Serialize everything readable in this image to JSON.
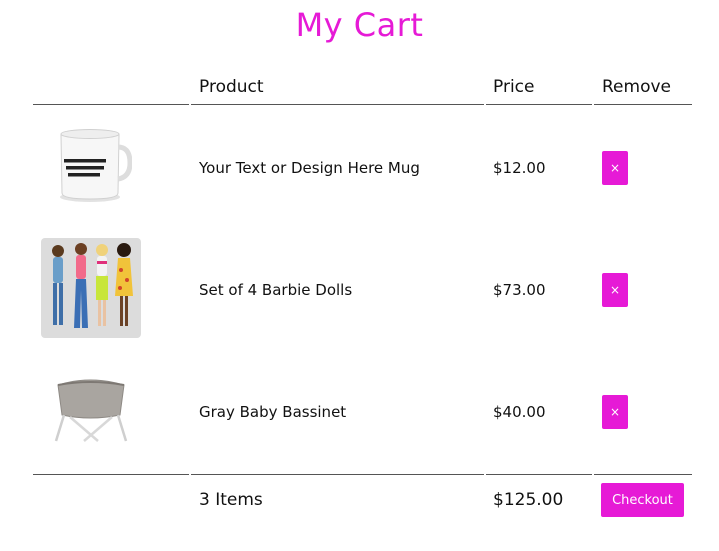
{
  "page": {
    "title": "My Cart"
  },
  "table": {
    "headers": {
      "product": "Product",
      "price": "Price",
      "remove": "Remove"
    },
    "rows": [
      {
        "product": "Your Text or Design Here Mug",
        "price": "$12.00",
        "remove_label": "×",
        "image": "mug-image"
      },
      {
        "product": "Set of 4 Barbie Dolls",
        "price": "$73.00",
        "remove_label": "×",
        "image": "dolls-image"
      },
      {
        "product": "Gray Baby Bassinet",
        "price": "$40.00",
        "remove_label": "×",
        "image": "bassinet-image"
      }
    ],
    "footer": {
      "items_count": "3 Items",
      "total": "$125.00",
      "checkout_label": "Checkout"
    }
  },
  "colors": {
    "accent": "#e61ad6"
  }
}
